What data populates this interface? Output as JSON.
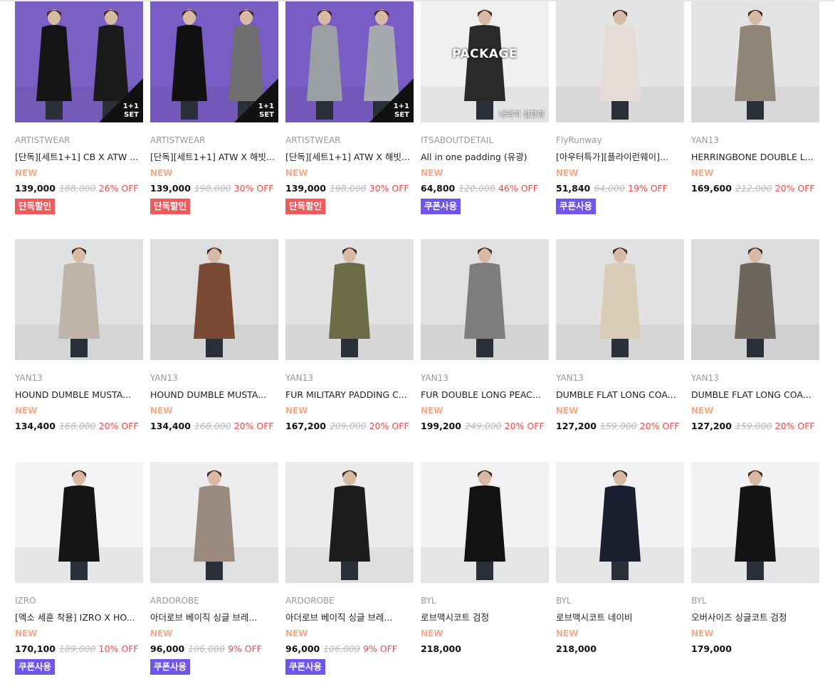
{
  "products": [
    {
      "brand": "ARTISTWEAR",
      "name": "[단독][세트1+1] CB X ATW ...",
      "new": "NEW",
      "price": "139,000",
      "orig": "188,000",
      "off": "26% OFF",
      "badge": "단독할인",
      "badge_type": "red",
      "overlay": "1+1\nSET",
      "photo": {
        "bg": "#7b5fc2",
        "figs": [
          "#151515",
          "#1a1a1a"
        ]
      }
    },
    {
      "brand": "ARTISTWEAR",
      "name": "[단독][세트1+1] ATW X 해빗...",
      "new": "NEW",
      "price": "139,000",
      "orig": "198,000",
      "off": "30% OFF",
      "badge": "단독할인",
      "badge_type": "red",
      "overlay": "1+1\nSET",
      "photo": {
        "bg": "#7a5dc4",
        "figs": [
          "#111111",
          "#6f6f6f"
        ]
      }
    },
    {
      "brand": "ARTISTWEAR",
      "name": "[단독][세트1+1] ATW X 해빗...",
      "new": "NEW",
      "price": "139,000",
      "orig": "198,000",
      "off": "30% OFF",
      "badge": "단독할인",
      "badge_type": "red",
      "overlay": "1+1\nSET",
      "photo": {
        "bg": "#7a5dc4",
        "figs": [
          "#9a9fa4",
          "#a6a9ad"
        ]
      }
    },
    {
      "brand": "ITSABOUTDETAIL",
      "name": "All in one padding (유광)",
      "new": "NEW",
      "price": "64,800",
      "orig": "120,000",
      "off": "46% OFF",
      "badge": "쿠폰사용",
      "badge_type": "purple",
      "package": "PACKAGE",
      "package_sub": "내외피 결합형",
      "photo": {
        "bg": "#f0f0f0",
        "figs": [
          "#2a2a2a"
        ]
      }
    },
    {
      "brand": "FlyRunway",
      "name": "[아우터특가][플라이런웨이]...",
      "new": "NEW",
      "price": "51,840",
      "orig": "64,000",
      "off": "19% OFF",
      "badge": "쿠폰사용",
      "badge_type": "purple",
      "photo": {
        "bg": "#e4e4e4",
        "figs": [
          "#e6dcd7"
        ]
      }
    },
    {
      "brand": "YAN13",
      "name": "HERRINGBONE DOUBLE L...",
      "new": "NEW",
      "price": "169,600",
      "orig": "212,000",
      "off": "20% OFF",
      "photo": {
        "bg": "#e3e3e3",
        "figs": [
          "#8f8678"
        ]
      }
    },
    {
      "brand": "YAN13",
      "name": "HOUND DUMBLE MUSTA...",
      "new": "NEW",
      "price": "134,400",
      "orig": "168,000",
      "off": "20% OFF",
      "photo": {
        "bg": "#dfe1e3",
        "figs": [
          "#bfb4a8"
        ]
      }
    },
    {
      "brand": "YAN13",
      "name": "HOUND DUMBLE MUSTA...",
      "new": "NEW",
      "price": "134,400",
      "orig": "168,000",
      "off": "20% OFF",
      "photo": {
        "bg": "#dedede",
        "figs": [
          "#7a4a34"
        ]
      }
    },
    {
      "brand": "YAN13",
      "name": "FUR MILITARY PADDING C...",
      "new": "NEW",
      "price": "167,200",
      "orig": "209,000",
      "off": "20% OFF",
      "photo": {
        "bg": "#e2e2e2",
        "figs": [
          "#6c6c47"
        ]
      }
    },
    {
      "brand": "YAN13",
      "name": "FUR DOUBLE LONG PEAC...",
      "new": "NEW",
      "price": "199,200",
      "orig": "249,000",
      "off": "20% OFF",
      "photo": {
        "bg": "#e0e0e0",
        "figs": [
          "#7d7d7d"
        ]
      }
    },
    {
      "brand": "YAN13",
      "name": "DUMBLE FLAT LONG COA...",
      "new": "NEW",
      "price": "127,200",
      "orig": "159,000",
      "off": "20% OFF",
      "photo": {
        "bg": "#e2e2e2",
        "figs": [
          "#d9cdb8"
        ]
      }
    },
    {
      "brand": "YAN13",
      "name": "DUMBLE FLAT LONG COA...",
      "new": "NEW",
      "price": "127,200",
      "orig": "159,000",
      "off": "20% OFF",
      "photo": {
        "bg": "#dcdcdc",
        "figs": [
          "#6c665c"
        ]
      }
    },
    {
      "brand": "IZRO",
      "name": "[엑소 세훈 착용] IZRO X HO...",
      "new": "NEW",
      "price": "170,100",
      "orig": "189,000",
      "off": "10% OFF",
      "badge": "쿠폰사용",
      "badge_type": "purple",
      "photo": {
        "bg": "#f4f4f4",
        "figs": [
          "#151515"
        ]
      }
    },
    {
      "brand": "ARDOROBE",
      "name": "아더로브 베이직 싱글 브레...",
      "new": "NEW",
      "price": "96,000",
      "orig": "106,000",
      "off": "9% OFF",
      "badge": "쿠폰사용",
      "badge_type": "purple",
      "photo": {
        "bg": "#ececec",
        "figs": [
          "#9a8b7e"
        ]
      }
    },
    {
      "brand": "ARDOROBE",
      "name": "아더로브 베이직 싱글 브레...",
      "new": "NEW",
      "price": "96,000",
      "orig": "106,000",
      "off": "9% OFF",
      "badge": "쿠폰사용",
      "badge_type": "purple",
      "photo": {
        "bg": "#ebebeb",
        "figs": [
          "#1c1c1c"
        ]
      }
    },
    {
      "brand": "BYL",
      "name": "로브맥시코트 검정",
      "new": "NEW",
      "price": "218,000",
      "photo": {
        "bg": "#f2f2f2",
        "figs": [
          "#121212"
        ]
      }
    },
    {
      "brand": "BYL",
      "name": "로브맥시코트 네이비",
      "new": "NEW",
      "price": "218,000",
      "photo": {
        "bg": "#f2f2f2",
        "figs": [
          "#1b1e2e"
        ]
      }
    },
    {
      "brand": "BYL",
      "name": "오버사이즈 싱글코트 검정",
      "new": "NEW",
      "price": "179,000",
      "photo": {
        "bg": "#f2f2f2",
        "figs": [
          "#141414"
        ]
      }
    }
  ]
}
